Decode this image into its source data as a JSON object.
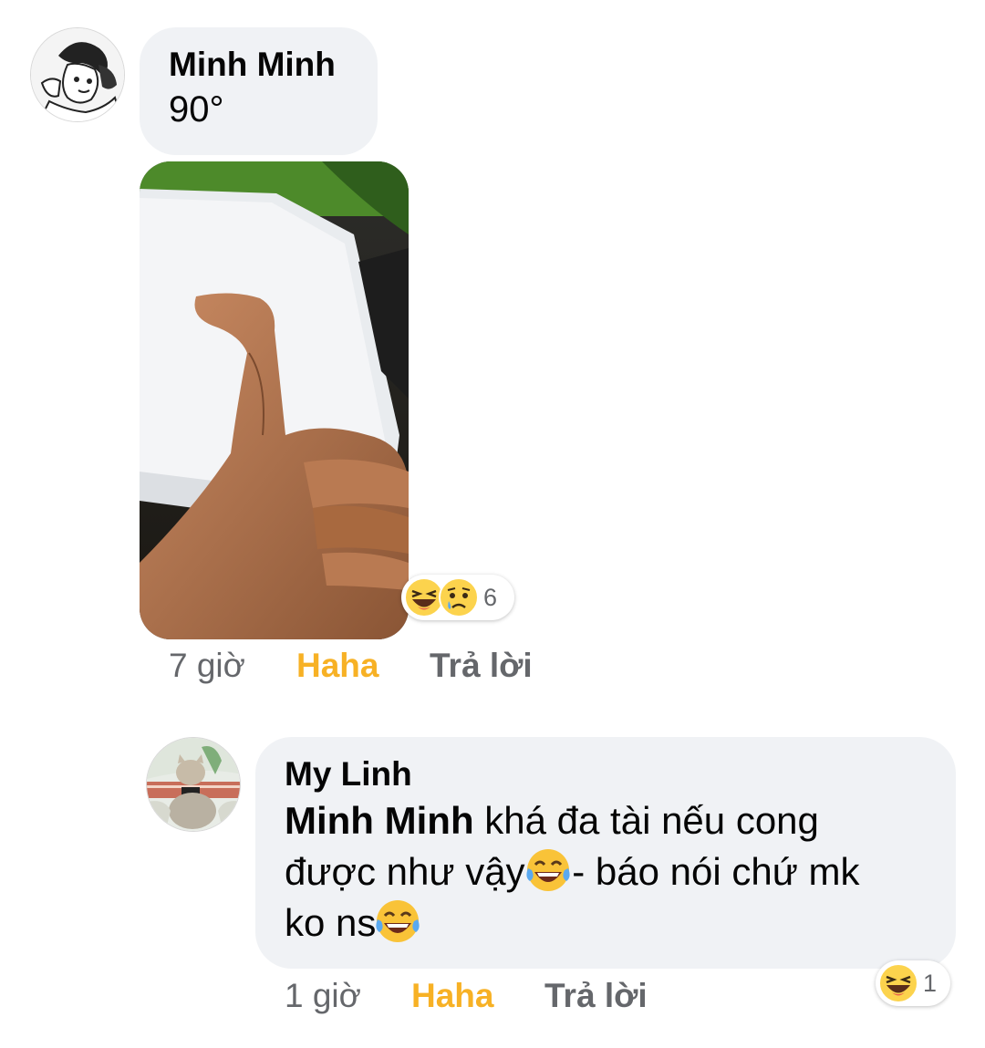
{
  "comments": [
    {
      "author": "Minh Minh",
      "text": "90°",
      "time": "7 giờ",
      "like_label": "Haha",
      "reply_label": "Trả lời",
      "reactions": {
        "icons": [
          "haha-icon",
          "sad-icon"
        ],
        "count": "6"
      }
    },
    {
      "author": "My Linh",
      "mention": "Minh Minh",
      "line1": " khá đa tài nếu cong",
      "line2a": "được như vậy ",
      "line2b": "- báo nói chứ mk",
      "line3": "ko ns",
      "time": "1 giờ",
      "like_label": "Haha",
      "reply_label": "Trả lời",
      "reactions": {
        "icons": [
          "haha-icon"
        ],
        "count": "1"
      }
    }
  ],
  "colors": {
    "bubble": "#f0f2f5",
    "secondary_text": "#65676b",
    "haha_accent": "#f7b125"
  }
}
